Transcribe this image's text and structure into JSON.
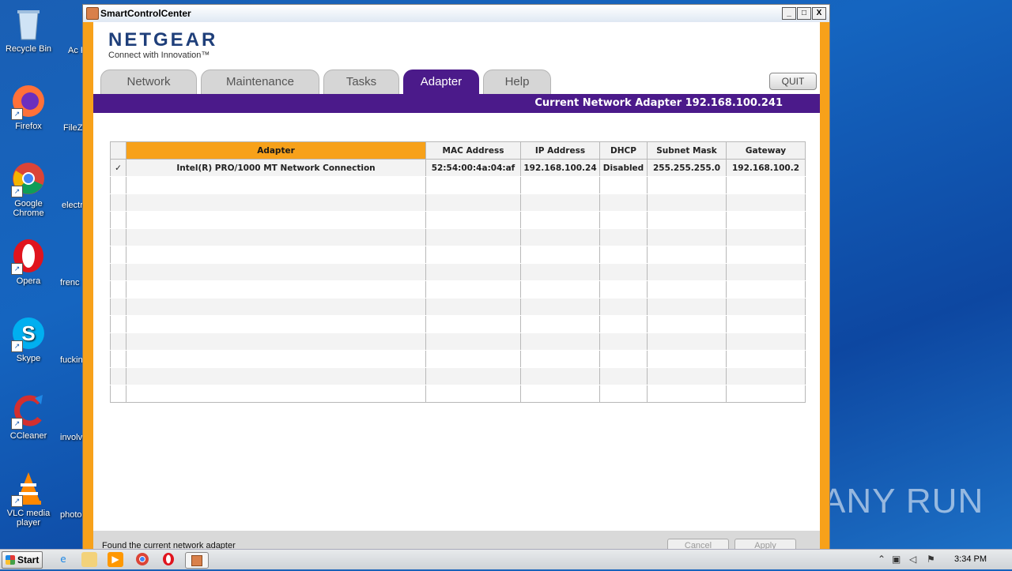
{
  "desktop": {
    "icons": [
      {
        "label": "Recycle Bin"
      },
      {
        "label": "Firefox"
      },
      {
        "label": "Google Chrome"
      },
      {
        "label": "Opera"
      },
      {
        "label": "Skype"
      },
      {
        "label": "CCleaner"
      },
      {
        "label": "VLC media player"
      }
    ],
    "partial_icons": [
      {
        "label": "Ac Rea"
      },
      {
        "label": "FileZi"
      },
      {
        "label": "electr"
      },
      {
        "label": "frenc"
      },
      {
        "label": "fuckin"
      },
      {
        "label": "involv"
      },
      {
        "label": "photo"
      }
    ],
    "watermark": "ANY RUN"
  },
  "window": {
    "title": "SmartControlCenter",
    "controls": {
      "minimize": "_",
      "maximize": "□",
      "close": "X"
    }
  },
  "app": {
    "brand": "NETGEAR",
    "tagline": "Connect with Innovation™",
    "tabs": [
      {
        "label": "Network",
        "active": false
      },
      {
        "label": "Maintenance",
        "active": false
      },
      {
        "label": "Tasks",
        "active": false
      },
      {
        "label": "Adapter",
        "active": true
      },
      {
        "label": "Help",
        "active": false
      }
    ],
    "quit_label": "QUIT",
    "current_adapter": "Current Network Adapter 192.168.100.241",
    "table": {
      "columns": [
        "",
        "Adapter",
        "MAC Address",
        "IP Address",
        "DHCP",
        "Subnet Mask",
        "Gateway"
      ],
      "rows": [
        {
          "check": "✓",
          "adapter": "Intel(R) PRO/1000 MT Network Connection",
          "mac": "52:54:00:4a:04:af",
          "ip": "192.168.100.24",
          "dhcp": "Disabled",
          "subnet": "255.255.255.0",
          "gateway": "192.168.100.2"
        }
      ]
    },
    "status_message": "Found the current network adapter",
    "cancel_label": "Cancel",
    "apply_label": "Apply"
  },
  "taskbar": {
    "start_label": "Start",
    "clock": "3:34 PM"
  },
  "colors": {
    "accent_orange": "#f7a11a",
    "netgear_purple": "#4b1a8a",
    "netgear_blue": "#1f3f7a"
  }
}
